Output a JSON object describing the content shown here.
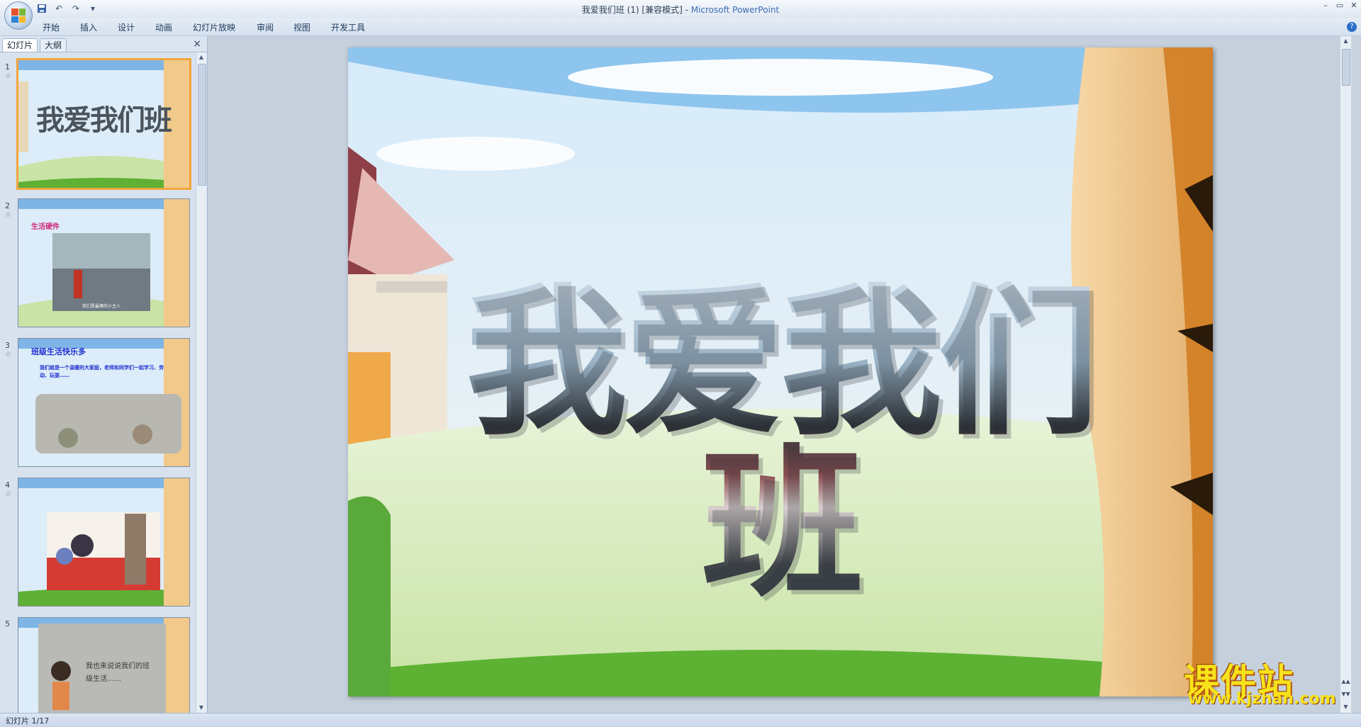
{
  "window": {
    "title": "我爱我们班 (1) [兼容模式] - ",
    "app_name": "Microsoft PowerPoint",
    "controls": [
      "–",
      "▭",
      "✕"
    ]
  },
  "ribbon": {
    "tabs": [
      "开始",
      "插入",
      "设计",
      "动画",
      "幻灯片放映",
      "审阅",
      "视图",
      "开发工具"
    ]
  },
  "left_pane": {
    "tab_slides": "幻灯片",
    "tab_outline": "大纲",
    "close": "×",
    "slides": [
      {
        "number": "1",
        "title": "我爱我们班"
      },
      {
        "number": "2",
        "heading": "生活硬件",
        "caption": "我们是最棒的小主人"
      },
      {
        "number": "3",
        "heading": "班级生活快乐多",
        "body": "我们就是一个温暖的大家庭，老师和同学们一起学习、劳动、玩耍……"
      },
      {
        "number": "4"
      },
      {
        "number": "5",
        "body": "我也来说说我们的班级生活……"
      }
    ]
  },
  "slide": {
    "title": "我爱我们班"
  },
  "watermark": {
    "text": "课件站",
    "url": "www.kjzhan.com"
  },
  "statusbar": {
    "slide_indicator": "幻灯片 1/17"
  },
  "colors": {
    "selected_border": "#f3a53d",
    "app_name_color": "#3a6bb3"
  }
}
